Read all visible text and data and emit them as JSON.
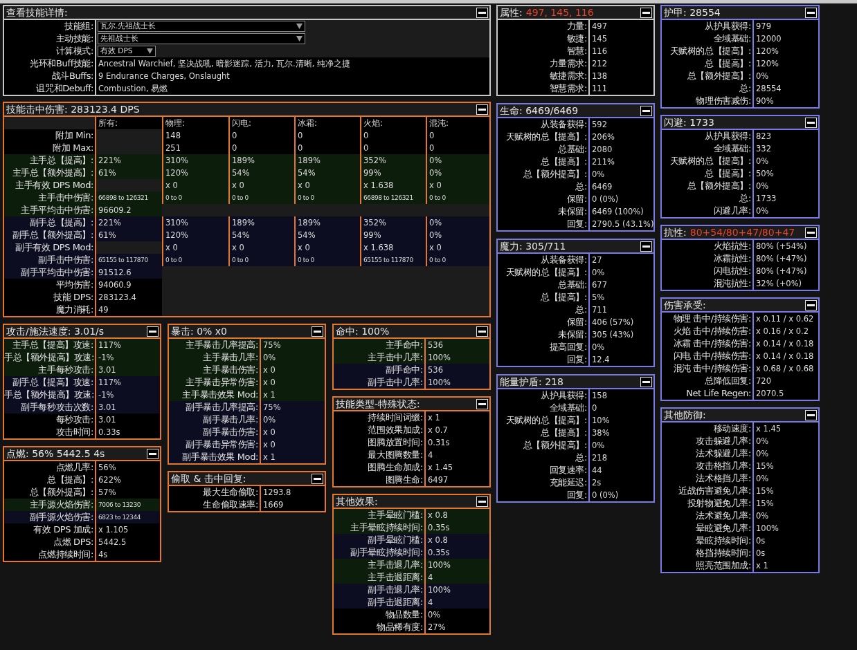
{
  "skill_details": {
    "title": "查看技能详情:",
    "kind": "general",
    "rows": [
      {
        "label": "技能组:",
        "kind": "select",
        "value": "瓦尔.先祖战士长"
      },
      {
        "label": "主动技能:",
        "kind": "select",
        "value": "先祖战士长"
      },
      {
        "label": "计算模式:",
        "kind": "select-short",
        "value": "有效 DPS"
      },
      {
        "label": "光环和Buff技能:",
        "kind": "text",
        "value": "Ancestral Warchief, 坚决战吼, 暗影迷踪, 活力, 瓦尔.清晰, 纯净之捷"
      },
      {
        "label": "战斗Buffs:",
        "kind": "text",
        "value": "9 Endurance Charges, Onslaught"
      },
      {
        "label": "诅咒和Debuff:",
        "kind": "text",
        "value": "Combustion, 易燃"
      }
    ]
  },
  "hit_damage": {
    "title": "技能击中伤害: 283123.4 DPS",
    "kind": "offense",
    "columns": [
      "所有:",
      "物理:",
      "闪电:",
      "冰霜:",
      "火焰:",
      "混沌:"
    ],
    "rows": [
      {
        "label": "附加 Min:",
        "kind": "plain",
        "elements": [
          "148",
          "0",
          "0",
          "0",
          "0"
        ]
      },
      {
        "label": "附加 Max:",
        "kind": "plain",
        "elements": [
          "251",
          "0",
          "0",
          "0",
          "0"
        ]
      },
      {
        "label": "主手总【提高】:",
        "kind": "main",
        "all": "221%",
        "elements": [
          "310%",
          "189%",
          "189%",
          "352%",
          "0%"
        ]
      },
      {
        "label": "主手总【额外提高】:",
        "kind": "main",
        "all": "61%",
        "elements": [
          "120%",
          "54%",
          "54%",
          "99%",
          "0%"
        ]
      },
      {
        "label": "主手有效 DPS Mod:",
        "kind": "main",
        "elements": [
          "x 0",
          "x 0",
          "x 0",
          "x 1.638",
          "x 0"
        ]
      },
      {
        "label": "主手击中伤害:",
        "kind": "main-range",
        "all": "66898 to 126321",
        "elements": [
          "0 to 0",
          "0 to 0",
          "0 to 0",
          "66898 to 126321",
          "0 to 0"
        ]
      },
      {
        "label": "主手平均击中伤害:",
        "kind": "main",
        "all": "96609.2"
      },
      {
        "label": "副手总【提高】:",
        "kind": "off",
        "all": "221%",
        "elements": [
          "310%",
          "189%",
          "189%",
          "352%",
          "0%"
        ]
      },
      {
        "label": "副手总【额外提高】:",
        "kind": "off",
        "all": "61%",
        "elements": [
          "120%",
          "54%",
          "54%",
          "99%",
          "0%"
        ]
      },
      {
        "label": "副手有效 DPS Mod:",
        "kind": "off",
        "elements": [
          "x 0",
          "x 0",
          "x 0",
          "x 1.638",
          "x 0"
        ]
      },
      {
        "label": "副手击中伤害:",
        "kind": "off-range",
        "all": "65155 to 117870",
        "elements": [
          "0 to 0",
          "0 to 0",
          "0 to 0",
          "65155 to 117870",
          "0 to 0"
        ]
      },
      {
        "label": "副手平均击中伤害:",
        "kind": "off",
        "all": "91512.6"
      },
      {
        "label": "平均伤害:",
        "kind": "plain",
        "all": "94060.9"
      },
      {
        "label": "技能 DPS:",
        "kind": "plain",
        "all": "283123.4"
      },
      {
        "label": "魔力消耗:",
        "kind": "plain",
        "all": "49"
      }
    ]
  },
  "offense_columns": [
    [
      {
        "title": "攻击/施法速度: 3.01/s",
        "kind": "offense",
        "rows": [
          {
            "label": "主手总【提高】攻速:",
            "kind": "main",
            "value": "117%"
          },
          {
            "label": "手总【额外提高】攻速:",
            "kind": "main",
            "value": "-1%"
          },
          {
            "label": "主手每秒攻击:",
            "kind": "main",
            "value": "3.01"
          },
          {
            "label": "副手总【提高】攻速:",
            "kind": "off",
            "value": "117%"
          },
          {
            "label": "手总【额外提高】攻速:",
            "kind": "off",
            "value": "-1%"
          },
          {
            "label": "副手每秒攻击次数:",
            "kind": "off",
            "value": "3.01"
          },
          {
            "label": "每秒攻击:",
            "kind": "plain",
            "value": "3.01"
          },
          {
            "label": "攻击时间:",
            "kind": "plain",
            "value": "0.33s"
          }
        ]
      },
      {
        "title": "点燃: 56% 5442.5 4s",
        "kind": "offense",
        "rows": [
          {
            "label": "点燃几率:",
            "kind": "plain",
            "value": "56%"
          },
          {
            "label": "总【提高】:",
            "kind": "plain",
            "value": "622%"
          },
          {
            "label": "总【额外提高】:",
            "kind": "plain",
            "value": "57%"
          },
          {
            "label": "主手源火焰伤害:",
            "kind": "main-range",
            "value": "7006 to 13230"
          },
          {
            "label": "副手源火焰伤害:",
            "kind": "off-range",
            "value": "6823 to 12344"
          },
          {
            "label": "有效 DPS 加成:",
            "kind": "plain",
            "value": "x 1.105"
          },
          {
            "label": "点燃 DPS:",
            "kind": "plain",
            "value": "5442.5"
          },
          {
            "label": "点燃持续时间:",
            "kind": "plain",
            "value": "4s"
          }
        ]
      }
    ],
    [
      {
        "title": "暴击: 0% x0",
        "kind": "offense",
        "rows": [
          {
            "label": "主手暴击几率提高:",
            "kind": "main",
            "value": "75%"
          },
          {
            "label": "主手暴击几率:",
            "kind": "main",
            "value": "0%"
          },
          {
            "label": "主手暴击伤害:",
            "kind": "main",
            "value": "x 0"
          },
          {
            "label": "主手暴击异常伤害:",
            "kind": "main",
            "value": "x 0"
          },
          {
            "label": "主手暴击效果 Mod:",
            "kind": "main",
            "value": "x 1"
          },
          {
            "label": "副手暴击几率提高:",
            "kind": "off",
            "value": "75%"
          },
          {
            "label": "副手暴击几率:",
            "kind": "off",
            "value": "0%"
          },
          {
            "label": "副手暴击伤害:",
            "kind": "off",
            "value": "x 0"
          },
          {
            "label": "副手暴击异常伤害:",
            "kind": "off",
            "value": "x 0"
          },
          {
            "label": "副手暴击效果 Mod:",
            "kind": "off",
            "value": "x 1"
          }
        ]
      },
      {
        "title": "偷取 & 击中回复:",
        "kind": "offense",
        "rows": [
          {
            "label": "最大生命偷取:",
            "kind": "plain",
            "value": "1293.8"
          },
          {
            "label": "生命偷取速率:",
            "kind": "plain",
            "value": "1669"
          }
        ]
      }
    ],
    [
      {
        "title": "命中: 100%",
        "kind": "offense",
        "rows": [
          {
            "label": "主手命中:",
            "kind": "main",
            "value": "536"
          },
          {
            "label": "主手击中几率:",
            "kind": "main",
            "value": "100%"
          },
          {
            "label": "副手命中:",
            "kind": "off",
            "value": "536"
          },
          {
            "label": "副手击中几率:",
            "kind": "off",
            "value": "100%"
          }
        ]
      },
      {
        "title": "技能类型-特殊状态:",
        "kind": "offense",
        "rows": [
          {
            "label": "持续时间词缀:",
            "kind": "plain",
            "value": "x 1"
          },
          {
            "label": "范围效果加成:",
            "kind": "plain",
            "value": "x 0.7"
          },
          {
            "label": "图腾放置时间:",
            "kind": "plain",
            "value": "0.31s"
          },
          {
            "label": "最大图腾数量:",
            "kind": "plain",
            "value": "4"
          },
          {
            "label": "图腾生命加成:",
            "kind": "plain",
            "value": "x 1.45"
          },
          {
            "label": "图腾生命:",
            "kind": "plain",
            "value": "6497"
          }
        ]
      },
      {
        "title": "其他效果:",
        "kind": "offense",
        "rows": [
          {
            "label": "主手晕眩门槛:",
            "kind": "main",
            "value": "x 0.8"
          },
          {
            "label": "主手晕眩持续时间:",
            "kind": "main",
            "value": "0.35s"
          },
          {
            "label": "副手晕眩门槛:",
            "kind": "off",
            "value": "x 0.8"
          },
          {
            "label": "副手晕眩持续时间:",
            "kind": "off",
            "value": "0.35s"
          },
          {
            "label": "主手击退几率:",
            "kind": "main",
            "value": "100%"
          },
          {
            "label": "主手击退距离:",
            "kind": "main",
            "value": "4"
          },
          {
            "label": "副手击退几率:",
            "kind": "off",
            "value": "100%"
          },
          {
            "label": "副手击退距离:",
            "kind": "off",
            "value": "4"
          },
          {
            "label": "物品数量:",
            "kind": "plain",
            "value": "0%"
          },
          {
            "label": "物品稀有度:",
            "kind": "plain",
            "value": "27%"
          }
        ]
      }
    ]
  ],
  "defense_columns": [
    [
      {
        "title": "属性:",
        "highlight": "497, 145, 116",
        "kind": "general",
        "rows": [
          {
            "label": "力量:",
            "value": "497"
          },
          {
            "label": "敏捷:",
            "value": "145"
          },
          {
            "label": "智慧:",
            "value": "116"
          },
          {
            "label": "力量需求:",
            "value": "212"
          },
          {
            "label": "敏捷需求:",
            "value": "138"
          },
          {
            "label": "智慧需求:",
            "value": "111"
          }
        ]
      },
      {
        "title": "生命: 6469/6469",
        "kind": "defense",
        "rows": [
          {
            "label": "从装备获得:",
            "value": "592"
          },
          {
            "label": "天赋树的总【提高】:",
            "value": "206%"
          },
          {
            "label": "总基础:",
            "value": "2080"
          },
          {
            "label": "总【提高】:",
            "value": "211%"
          },
          {
            "label": "总【额外提高】:",
            "value": "0%"
          },
          {
            "label": "总:",
            "value": "6469"
          },
          {
            "label": "保留:",
            "value": "0 (0%)"
          },
          {
            "label": "未保留:",
            "value": "6469 (100%)"
          },
          {
            "label": "回复:",
            "value": "2790.5 (43.1%)"
          }
        ]
      },
      {
        "title": "魔力: 305/711",
        "kind": "defense",
        "rows": [
          {
            "label": "从装备获得:",
            "value": "27"
          },
          {
            "label": "天赋树的总【提高】:",
            "value": "0%"
          },
          {
            "label": "总基础:",
            "value": "677"
          },
          {
            "label": "总【提高】:",
            "value": "5%"
          },
          {
            "label": "总:",
            "value": "711"
          },
          {
            "label": "保留:",
            "value": "406 (57%)"
          },
          {
            "label": "未保留:",
            "value": "305 (43%)"
          },
          {
            "label": "提高回复:",
            "value": "0%"
          },
          {
            "label": "回复:",
            "value": "12.4"
          }
        ]
      },
      {
        "title": "能量护盾: 218",
        "kind": "defense",
        "rows": [
          {
            "label": "从护具获得:",
            "value": "158"
          },
          {
            "label": "全域基础:",
            "value": "0"
          },
          {
            "label": "天赋树的总【提高】:",
            "value": "10%"
          },
          {
            "label": "总【提高】:",
            "value": "38%"
          },
          {
            "label": "总【额外提高】:",
            "value": "0%"
          },
          {
            "label": "总:",
            "value": "218"
          },
          {
            "label": "回复速率:",
            "value": "44"
          },
          {
            "label": "充能延迟:",
            "value": "2s"
          },
          {
            "label": "回复:",
            "value": "0 (0%)"
          }
        ]
      }
    ],
    [
      {
        "title": "护甲: 28554",
        "kind": "defense",
        "rows": [
          {
            "label": "从护具获得:",
            "value": "979"
          },
          {
            "label": "全域基础:",
            "value": "12000"
          },
          {
            "label": "天赋树的总【提高】:",
            "value": "120%"
          },
          {
            "label": "总【提高】:",
            "value": "120%"
          },
          {
            "label": "总【额外提高】:",
            "value": "0%"
          },
          {
            "label": "总:",
            "value": "28554"
          },
          {
            "label": "物理伤害减伤:",
            "value": "90%"
          }
        ]
      },
      {
        "title": "闪避: 1733",
        "kind": "defense",
        "rows": [
          {
            "label": "从护具获得:",
            "value": "823"
          },
          {
            "label": "全域基础:",
            "value": "332"
          },
          {
            "label": "天赋树的总【提高】:",
            "value": "0%"
          },
          {
            "label": "总【提高】:",
            "value": "50%"
          },
          {
            "label": "总【额外提高】:",
            "value": "0%"
          },
          {
            "label": "总:",
            "value": "1733"
          },
          {
            "label": "闪避几率:",
            "value": "0%"
          }
        ]
      },
      {
        "title": "抗性:",
        "highlight": "80+54/80+47/80+47",
        "kind": "defense",
        "rows": [
          {
            "label": "火焰抗性:",
            "value": "80% (+54%)"
          },
          {
            "label": "冰霜抗性:",
            "value": "80% (+47%)"
          },
          {
            "label": "闪电抗性:",
            "value": "80% (+47%)"
          },
          {
            "label": "混沌抗性:",
            "value": "32% (+0%)"
          }
        ]
      },
      {
        "title": "伤害承受:",
        "kind": "defense",
        "rows": [
          {
            "label": "物理 击中/持续伤害:",
            "value": "x 0.11 / x 0.62"
          },
          {
            "label": "火焰 击中/持续伤害:",
            "value": "x 0.16 / x 0.2"
          },
          {
            "label": "冰霜 击中/持续伤害:",
            "value": "x 0.14 / x 0.18"
          },
          {
            "label": "闪电 击中/持续伤害:",
            "value": "x 0.14 / x 0.18"
          },
          {
            "label": "混沌 击中/持续伤害:",
            "value": "x 0.68 / x 0.68"
          },
          {
            "label": "总降低回复:",
            "value": "720"
          },
          {
            "label": "Net Life Regen:",
            "value": "2070.5"
          }
        ]
      },
      {
        "title": "其他防御:",
        "kind": "defense",
        "rows": [
          {
            "label": "移动速度:",
            "value": "x 1.45"
          },
          {
            "label": "攻击躲避几率:",
            "value": "0%"
          },
          {
            "label": "法术躲避几率:",
            "value": "0%"
          },
          {
            "label": "攻击格挡几率:",
            "value": "15%"
          },
          {
            "label": "法术格挡几率:",
            "value": "0%"
          },
          {
            "label": "近战伤害避免几率:",
            "value": "15%"
          },
          {
            "label": "投射物避免几率:",
            "value": "15%"
          },
          {
            "label": "法术避免几率:",
            "value": "0%"
          },
          {
            "label": "晕眩避免几率:",
            "value": "100%"
          },
          {
            "label": "晕眩持续时间:",
            "value": "0s"
          },
          {
            "label": "格挡持续时间:",
            "value": "0s"
          },
          {
            "label": "照亮范围加成:",
            "value": "x 1"
          }
        ]
      }
    ]
  ]
}
